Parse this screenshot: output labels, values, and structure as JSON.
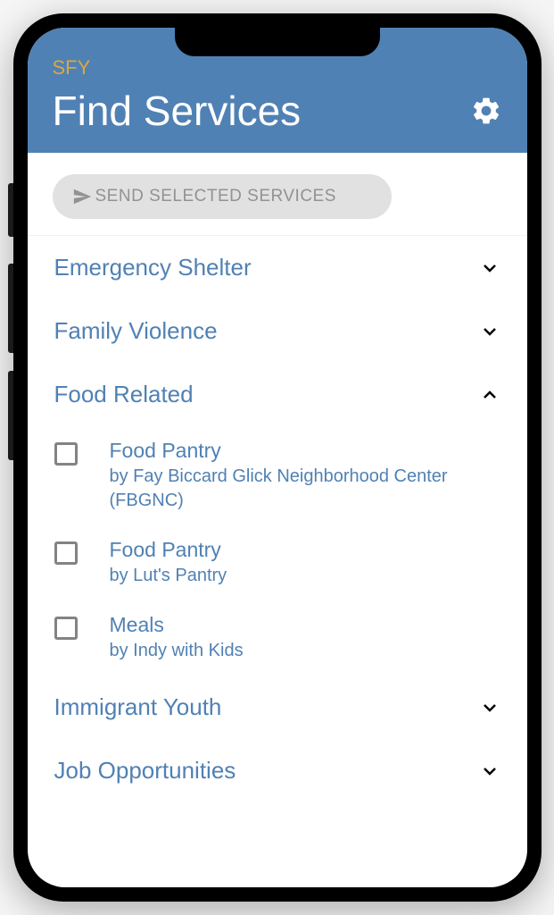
{
  "brand": "SFY",
  "title": "Find Services",
  "sendButton": {
    "label": "SEND SELECTED SERVICES"
  },
  "categories": [
    {
      "label": "Emergency Shelter",
      "expanded": false
    },
    {
      "label": "Family Violence",
      "expanded": false
    },
    {
      "label": "Food Related",
      "expanded": true,
      "items": [
        {
          "title": "Food Pantry",
          "by": "by Fay Biccard Glick Neighborhood Center (FBGNC)"
        },
        {
          "title": "Food Pantry",
          "by": "by Lut's Pantry"
        },
        {
          "title": "Meals",
          "by": "by Indy with Kids"
        }
      ]
    },
    {
      "label": "Immigrant Youth",
      "expanded": false
    },
    {
      "label": "Job Opportunities",
      "expanded": false
    }
  ]
}
